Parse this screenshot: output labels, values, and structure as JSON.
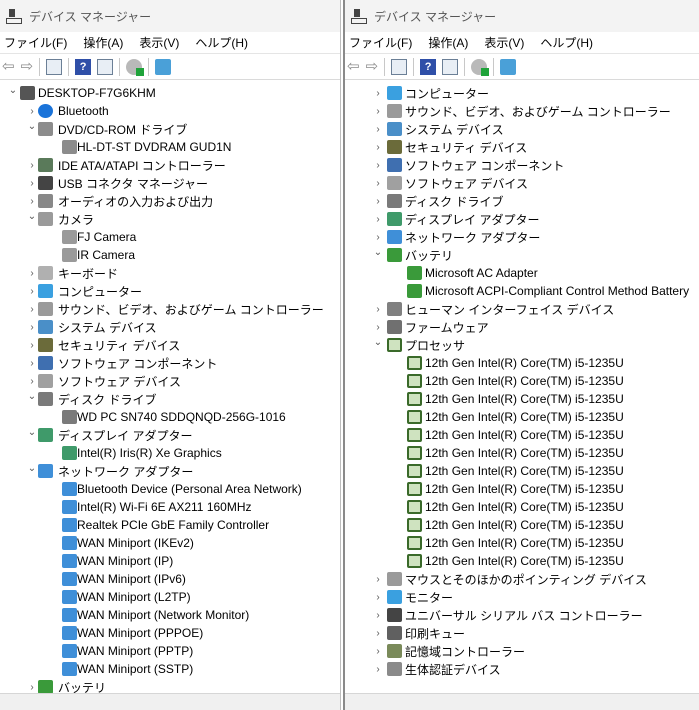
{
  "windows": [
    {
      "title": "デバイス マネージャー",
      "menu": [
        "ファイル(F)",
        "操作(A)",
        "表示(V)",
        "ヘルプ(H)"
      ],
      "tree": [
        {
          "level": 0,
          "state": "expanded",
          "icon": "computer",
          "label": "DESKTOP-F7G6KHM"
        },
        {
          "level": 1,
          "state": "collapsed",
          "icon": "bluetooth",
          "label": "Bluetooth"
        },
        {
          "level": 1,
          "state": "expanded",
          "icon": "dvd",
          "label": "DVD/CD-ROM ドライブ"
        },
        {
          "level": 2,
          "icon": "dvd",
          "label": "HL-DT-ST DVDRAM GUD1N"
        },
        {
          "level": 1,
          "state": "collapsed",
          "icon": "ide",
          "label": "IDE ATA/ATAPI コントローラー"
        },
        {
          "level": 1,
          "state": "collapsed",
          "icon": "usb",
          "label": "USB コネクタ マネージャー"
        },
        {
          "level": 1,
          "state": "collapsed",
          "icon": "audio",
          "label": "オーディオの入力および出力"
        },
        {
          "level": 1,
          "state": "expanded",
          "icon": "camera",
          "label": "カメラ"
        },
        {
          "level": 2,
          "icon": "camera",
          "label": "FJ Camera"
        },
        {
          "level": 2,
          "icon": "camera",
          "label": "IR Camera"
        },
        {
          "level": 1,
          "state": "collapsed",
          "icon": "keyboard",
          "label": "キーボード"
        },
        {
          "level": 1,
          "state": "collapsed",
          "icon": "monitor",
          "label": "コンピューター"
        },
        {
          "level": 1,
          "state": "collapsed",
          "icon": "speaker",
          "label": "サウンド、ビデオ、およびゲーム コントローラー"
        },
        {
          "level": 1,
          "state": "collapsed",
          "icon": "system",
          "label": "システム デバイス"
        },
        {
          "level": 1,
          "state": "collapsed",
          "icon": "security",
          "label": "セキュリティ デバイス"
        },
        {
          "level": 1,
          "state": "collapsed",
          "icon": "software-component",
          "label": "ソフトウェア コンポーネント"
        },
        {
          "level": 1,
          "state": "collapsed",
          "icon": "software-device",
          "label": "ソフトウェア デバイス"
        },
        {
          "level": 1,
          "state": "expanded",
          "icon": "disk",
          "label": "ディスク ドライブ"
        },
        {
          "level": 2,
          "icon": "disk",
          "label": "WD PC SN740 SDDQNQD-256G-1016"
        },
        {
          "level": 1,
          "state": "expanded",
          "icon": "display",
          "label": "ディスプレイ アダプター"
        },
        {
          "level": 2,
          "icon": "display",
          "label": "Intel(R) Iris(R) Xe Graphics"
        },
        {
          "level": 1,
          "state": "expanded",
          "icon": "network",
          "label": "ネットワーク アダプター"
        },
        {
          "level": 2,
          "icon": "network",
          "label": "Bluetooth Device (Personal Area Network)"
        },
        {
          "level": 2,
          "icon": "network",
          "label": "Intel(R) Wi-Fi 6E AX211 160MHz"
        },
        {
          "level": 2,
          "icon": "network",
          "label": "Realtek PCIe GbE Family Controller"
        },
        {
          "level": 2,
          "icon": "network",
          "label": "WAN Miniport (IKEv2)"
        },
        {
          "level": 2,
          "icon": "network",
          "label": "WAN Miniport (IP)"
        },
        {
          "level": 2,
          "icon": "network",
          "label": "WAN Miniport (IPv6)"
        },
        {
          "level": 2,
          "icon": "network",
          "label": "WAN Miniport (L2TP)"
        },
        {
          "level": 2,
          "icon": "network",
          "label": "WAN Miniport (Network Monitor)"
        },
        {
          "level": 2,
          "icon": "network",
          "label": "WAN Miniport (PPPOE)"
        },
        {
          "level": 2,
          "icon": "network",
          "label": "WAN Miniport (PPTP)"
        },
        {
          "level": 2,
          "icon": "network",
          "label": "WAN Miniport (SSTP)"
        },
        {
          "level": 1,
          "state": "collapsed",
          "icon": "battery",
          "label": "バッテリ"
        }
      ]
    },
    {
      "title": "デバイス マネージャー",
      "menu": [
        "ファイル(F)",
        "操作(A)",
        "表示(V)",
        "ヘルプ(H)"
      ],
      "tree": [
        {
          "level": 1,
          "state": "collapsed",
          "icon": "monitor",
          "label": "コンピューター"
        },
        {
          "level": 1,
          "state": "collapsed",
          "icon": "speaker",
          "label": "サウンド、ビデオ、およびゲーム コントローラー"
        },
        {
          "level": 1,
          "state": "collapsed",
          "icon": "system",
          "label": "システム デバイス"
        },
        {
          "level": 1,
          "state": "collapsed",
          "icon": "security",
          "label": "セキュリティ デバイス"
        },
        {
          "level": 1,
          "state": "collapsed",
          "icon": "software-component",
          "label": "ソフトウェア コンポーネント"
        },
        {
          "level": 1,
          "state": "collapsed",
          "icon": "software-device",
          "label": "ソフトウェア デバイス"
        },
        {
          "level": 1,
          "state": "collapsed",
          "icon": "disk",
          "label": "ディスク ドライブ"
        },
        {
          "level": 1,
          "state": "collapsed",
          "icon": "display",
          "label": "ディスプレイ アダプター"
        },
        {
          "level": 1,
          "state": "collapsed",
          "icon": "network",
          "label": "ネットワーク アダプター"
        },
        {
          "level": 1,
          "state": "expanded",
          "icon": "battery",
          "label": "バッテリ"
        },
        {
          "level": 2,
          "icon": "battery",
          "label": "Microsoft AC Adapter"
        },
        {
          "level": 2,
          "icon": "battery",
          "label": "Microsoft ACPI-Compliant Control Method Battery"
        },
        {
          "level": 1,
          "state": "collapsed",
          "icon": "hid",
          "label": "ヒューマン インターフェイス デバイス"
        },
        {
          "level": 1,
          "state": "collapsed",
          "icon": "firmware",
          "label": "ファームウェア"
        },
        {
          "level": 1,
          "state": "expanded",
          "icon": "processor",
          "label": "プロセッサ"
        },
        {
          "level": 2,
          "icon": "processor",
          "label": "12th Gen Intel(R) Core(TM) i5-1235U"
        },
        {
          "level": 2,
          "icon": "processor",
          "label": "12th Gen Intel(R) Core(TM) i5-1235U"
        },
        {
          "level": 2,
          "icon": "processor",
          "label": "12th Gen Intel(R) Core(TM) i5-1235U"
        },
        {
          "level": 2,
          "icon": "processor",
          "label": "12th Gen Intel(R) Core(TM) i5-1235U"
        },
        {
          "level": 2,
          "icon": "processor",
          "label": "12th Gen Intel(R) Core(TM) i5-1235U"
        },
        {
          "level": 2,
          "icon": "processor",
          "label": "12th Gen Intel(R) Core(TM) i5-1235U"
        },
        {
          "level": 2,
          "icon": "processor",
          "label": "12th Gen Intel(R) Core(TM) i5-1235U"
        },
        {
          "level": 2,
          "icon": "processor",
          "label": "12th Gen Intel(R) Core(TM) i5-1235U"
        },
        {
          "level": 2,
          "icon": "processor",
          "label": "12th Gen Intel(R) Core(TM) i5-1235U"
        },
        {
          "level": 2,
          "icon": "processor",
          "label": "12th Gen Intel(R) Core(TM) i5-1235U"
        },
        {
          "level": 2,
          "icon": "processor",
          "label": "12th Gen Intel(R) Core(TM) i5-1235U"
        },
        {
          "level": 2,
          "icon": "processor",
          "label": "12th Gen Intel(R) Core(TM) i5-1235U"
        },
        {
          "level": 1,
          "state": "collapsed",
          "icon": "mouse",
          "label": "マウスとそのほかのポインティング デバイス"
        },
        {
          "level": 1,
          "state": "collapsed",
          "icon": "monitor",
          "label": "モニター"
        },
        {
          "level": 1,
          "state": "collapsed",
          "icon": "usb",
          "label": "ユニバーサル シリアル バス コントローラー"
        },
        {
          "level": 1,
          "state": "collapsed",
          "icon": "printer",
          "label": "印刷キュー"
        },
        {
          "level": 1,
          "state": "collapsed",
          "icon": "storage",
          "label": "記憶域コントローラー"
        },
        {
          "level": 1,
          "state": "collapsed",
          "icon": "biometric",
          "label": "生体認証デバイス"
        }
      ]
    }
  ],
  "icon_colors": {
    "computer": "#555555",
    "bluetooth": "#1a73d9",
    "dvd": "#8c8c8c",
    "ide": "#5a7a5a",
    "usb": "#444444",
    "audio": "#888888",
    "camera": "#9a9a9a",
    "keyboard": "#b0b0b0",
    "monitor": "#3aa0e0",
    "speaker": "#9a9a9a",
    "system": "#4a8fc8",
    "security": "#6b6b3a",
    "software-component": "#3f6fb0",
    "software-device": "#a0a0a0",
    "disk": "#7a7a7a",
    "display": "#3f9a6a",
    "network": "#3f8fd8",
    "battery": "#3a9a3a",
    "hid": "#808080",
    "firmware": "#707070",
    "processor": "#3a6a2a",
    "mouse": "#9a9a9a",
    "printer": "#606060",
    "storage": "#7a8a5a",
    "biometric": "#8a8a8a"
  }
}
